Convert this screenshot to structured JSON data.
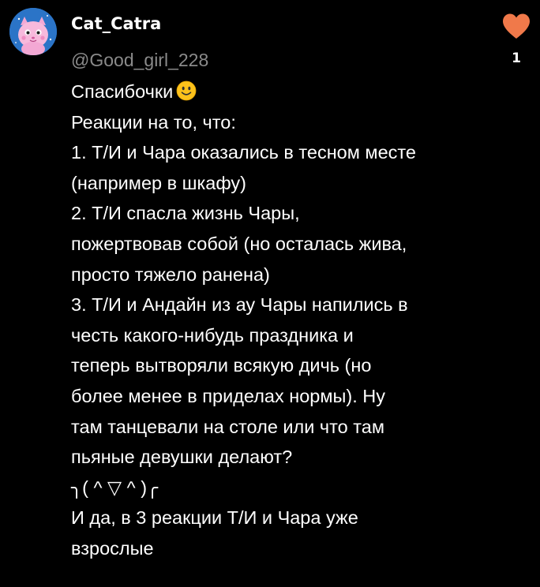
{
  "comment": {
    "author": {
      "username": "Cat_Catra",
      "avatar_icon": "pink-cat-avatar-icon"
    },
    "mention": "@Good_girl_228",
    "lines": [
      "Спасибочки",
      "Реакции на то, что:",
      "1. Т/И и Чара оказались в тесном месте",
      "(например в шкафу)",
      "2. Т/И спасла жизнь Чары,",
      "пожертвовав собой (но осталась жива,",
      "просто тяжело ранена)",
      "3. Т/И и Андайн из ау Чары напились в",
      "честь какого-нибудь праздника и",
      "теперь вытворяли всякую дичь (но",
      "более менее в приделах нормы). Ну",
      "там танцевали на столе или что там",
      "пьяные девушки делают?",
      "╮( ^ ▽ ^ )╭",
      "И да, в 3 реакции Т/И и Чара уже",
      "взрослые"
    ],
    "first_line_emoji": "slightly-smiling-face-icon",
    "likes": {
      "icon": "heart-icon",
      "count": "1",
      "color": "#f0794a"
    }
  },
  "colors": {
    "background": "#000000",
    "text": "#ffffff",
    "muted": "#8a8a8a"
  }
}
